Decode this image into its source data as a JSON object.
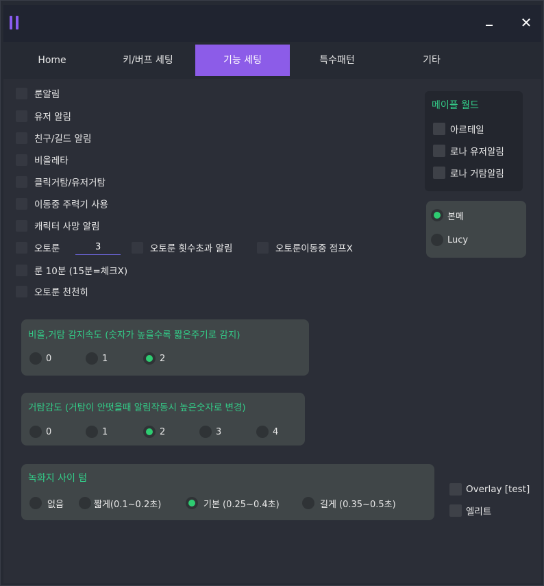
{
  "tabs": [
    "Home",
    "키/버프 세팅",
    "기능 세팅",
    "특수패턴",
    "기타"
  ],
  "checks": {
    "rune_alert": "룬알림",
    "user_alert": "유저 알림",
    "friend_guild_alert": "친구/길드 알림",
    "violetta": "비올레타",
    "click_lie_user_lie": "클릭거탐/유저거탐",
    "use_main_while_moving": "이동중 주력기 사용",
    "char_death_alert": "캐릭터 사망 알림",
    "auto_rune": "오토룬",
    "auto_rune_value": "3",
    "auto_rune_over_alert": "오토룬 횟수초과 알림",
    "auto_rune_jump_x": "오토룬이동중 점프X",
    "rune_10min": "룬 10분 (15분=체크X)",
    "auto_rune_slow": "오토룬 천천히"
  },
  "groups": {
    "violetta_speed": {
      "title": "비올,거탐 감지속도 (숫자가 높을수록 짧은주기로 감지)",
      "options": [
        "0",
        "1",
        "2"
      ],
      "selected": "2"
    },
    "lie_sensitivity": {
      "title": "거탐감도 (거탐이 안떳을때 알림작동시 높은숫자로 변경)",
      "options": [
        "0",
        "1",
        "2",
        "3",
        "4"
      ],
      "selected": "2"
    },
    "record_interval": {
      "title": "녹화지 사이 텀",
      "options": [
        "없음",
        "짧게(0.1~0.2초)",
        "기본 (0.25~0.4초)",
        "길게 (0.35~0.5초)"
      ],
      "selected": "기본 (0.25~0.4초)"
    }
  },
  "maple_world": {
    "title": "메이플 월드",
    "items": [
      "아르테일",
      "로나 유저알림",
      "로나 거탐알림"
    ]
  },
  "server": {
    "options": [
      "본메",
      "Lucy"
    ],
    "selected": "본메"
  },
  "extra": {
    "overlay": "Overlay [test]",
    "elite": "엘리트"
  },
  "colors": {
    "accent": "#8c5ce8",
    "green": "#33cc88",
    "radio_on": "#2ecc71"
  }
}
